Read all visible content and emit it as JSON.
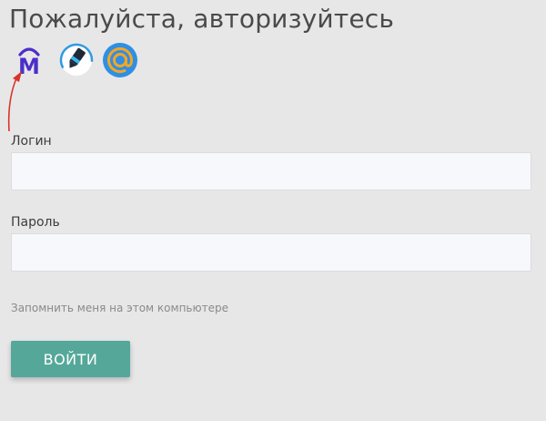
{
  "page": {
    "title": "Пожалуйста, авторизуйтесь"
  },
  "social": [
    {
      "name": "mos-id",
      "icon": "mos-m-icon",
      "letter": "M"
    },
    {
      "name": "pen-service",
      "icon": "pen-icon"
    },
    {
      "name": "mail-ru",
      "icon": "mail-at-icon"
    }
  ],
  "form": {
    "login_label": "Логин",
    "login_value": "",
    "password_label": "Пароль",
    "password_value": "",
    "remember_label": "Запомнить меня на этом компьютере",
    "submit_label": "ВОЙТИ"
  },
  "colors": {
    "background": "#e8e7e8",
    "accent": "#55a899",
    "mos_purple": "#4b2fc9",
    "annotation_arrow": "#d9342b"
  }
}
